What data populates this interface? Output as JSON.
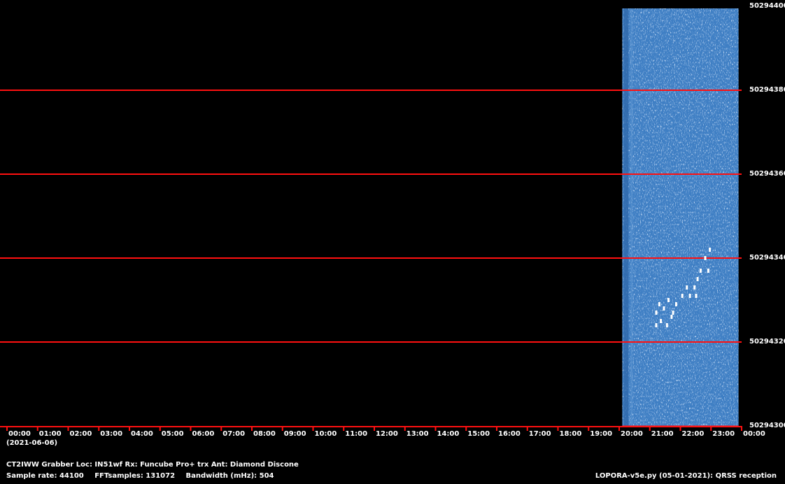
{
  "chart_data": {
    "type": "heatmap",
    "title": "",
    "x_tick_labels": [
      "00:00",
      "01:00",
      "02:00",
      "03:00",
      "04:00",
      "05:00",
      "06:00",
      "07:00",
      "08:00",
      "09:00",
      "10:00",
      "11:00",
      "12:00",
      "13:00",
      "14:00",
      "15:00",
      "16:00",
      "17:00",
      "18:00",
      "19:00",
      "20:00",
      "21:00",
      "22:00",
      "23:00",
      "00:00"
    ],
    "date": "(2021-06-06)",
    "y_tick_labels": [
      "50294400",
      "50294380",
      "50294360",
      "50294340",
      "50294320",
      "50294300"
    ],
    "ylim": [
      50294300,
      50294400
    ],
    "data_window_hours": [
      20.1,
      23.9
    ],
    "signal_color": "#ffffff",
    "background_color": "#000000",
    "waterfall_color": "#3f7fc4",
    "gridline_color": "#ff1010"
  },
  "info": {
    "line1": "CT2IWW Grabber Loc: IN51wf Rx: Funcube Pro+ trx Ant: Diamond Discone",
    "sample_rate": "Sample rate: 44100",
    "fft_samples": "FFTsamples: 131072",
    "bandwidth": "Bandwidth (mHz): 504",
    "credit": "LOPORA-v5e.py (05-01-2021): QRSS reception"
  }
}
